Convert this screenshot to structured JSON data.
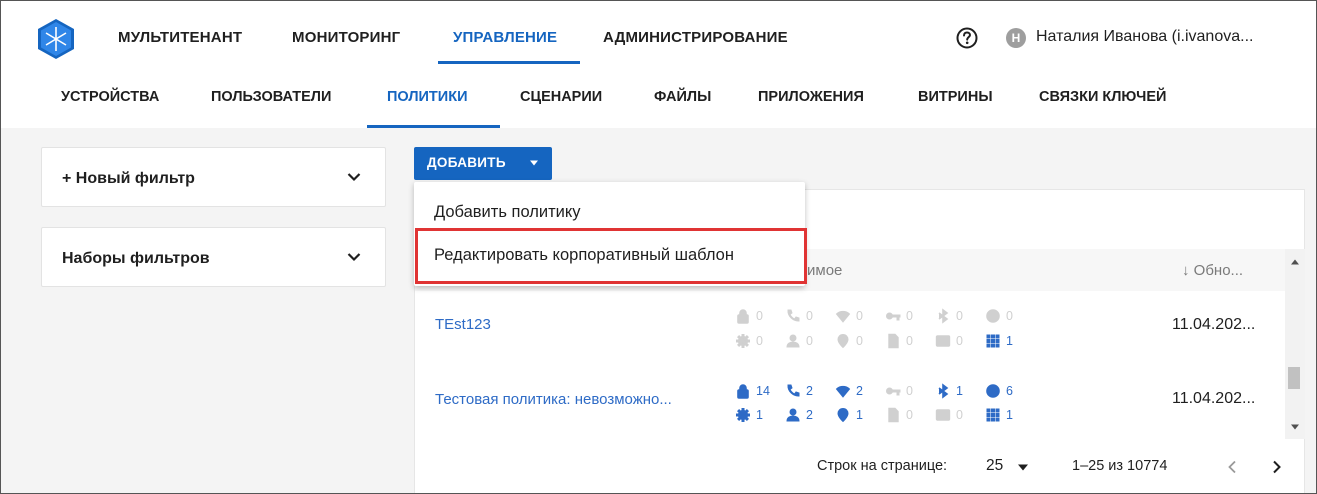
{
  "topnav": {
    "items": [
      "МУЛЬТИТЕНАНТ",
      "МОНИТОРИНГ",
      "УПРАВЛЕНИЕ",
      "АДМИНИСТРИРОВАНИЕ"
    ],
    "active": "УПРАВЛЕНИЕ"
  },
  "user": {
    "avatar_letter": "Н",
    "name": "Наталия Иванова (i.ivanova..."
  },
  "subnav": {
    "items": [
      "УСТРОЙСТВА",
      "ПОЛЬЗОВАТЕЛИ",
      "ПОЛИТИКИ",
      "СЦЕНАРИИ",
      "ФАЙЛЫ",
      "ПРИЛОЖЕНИЯ",
      "ВИТРИНЫ",
      "СВЯЗКИ КЛЮЧЕЙ"
    ],
    "active": "ПОЛИТИКИ"
  },
  "filters": {
    "new_filter": "+ Новый фильтр",
    "filter_sets": "Наборы фильтров"
  },
  "add_button": {
    "label": "ДОБАВИТЬ"
  },
  "dropdown": {
    "items": [
      "Добавить политику",
      "Редактировать корпоративный шаблон"
    ]
  },
  "table": {
    "header_partial": "имое",
    "header_updated": "↓ Обно...",
    "rows": [
      {
        "name": "TEst123",
        "date": "11.04.202...",
        "stats": [
          {
            "icon": "lock-icon",
            "value": "0",
            "active": false
          },
          {
            "icon": "phone-icon",
            "value": "0",
            "active": false
          },
          {
            "icon": "wifi-icon",
            "value": "0",
            "active": false
          },
          {
            "icon": "key-icon",
            "value": "0",
            "active": false
          },
          {
            "icon": "bluetooth-icon",
            "value": "0",
            "active": false
          },
          {
            "icon": "clock-icon",
            "value": "0",
            "active": false
          },
          {
            "icon": "gear-icon",
            "value": "0",
            "active": false
          },
          {
            "icon": "person-icon",
            "value": "0",
            "active": false
          },
          {
            "icon": "location-icon",
            "value": "0",
            "active": false
          },
          {
            "icon": "file-icon",
            "value": "0",
            "active": false
          },
          {
            "icon": "terminal-icon",
            "value": "0",
            "active": false
          },
          {
            "icon": "apps-grid-icon",
            "value": "1",
            "active": true
          }
        ]
      },
      {
        "name": "Тестовая политика: невозможно...",
        "date": "11.04.202...",
        "stats": [
          {
            "icon": "lock-icon",
            "value": "14",
            "active": true
          },
          {
            "icon": "phone-icon",
            "value": "2",
            "active": true
          },
          {
            "icon": "wifi-icon",
            "value": "2",
            "active": true
          },
          {
            "icon": "key-icon",
            "value": "0",
            "active": false
          },
          {
            "icon": "bluetooth-icon",
            "value": "1",
            "active": true
          },
          {
            "icon": "clock-icon",
            "value": "6",
            "active": true
          },
          {
            "icon": "gear-icon",
            "value": "1",
            "active": true
          },
          {
            "icon": "person-icon",
            "value": "2",
            "active": true
          },
          {
            "icon": "location-icon",
            "value": "1",
            "active": true
          },
          {
            "icon": "file-icon",
            "value": "0",
            "active": false
          },
          {
            "icon": "terminal-icon",
            "value": "0",
            "active": false
          },
          {
            "icon": "apps-grid-icon",
            "value": "1",
            "active": true
          }
        ]
      }
    ]
  },
  "pagination": {
    "rows_per_page_label": "Строк на странице:",
    "rows_per_page_value": "25",
    "range": "1–25 из 10774"
  },
  "colors": {
    "accent": "#1565c0",
    "link": "#2e6bc6",
    "highlight": "#e03434"
  }
}
